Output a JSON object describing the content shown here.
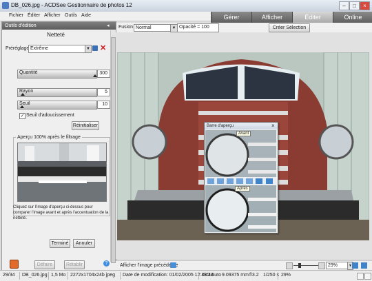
{
  "window": {
    "title": "DB_026.jpg - ACDSee Gestionnaire de photos 12"
  },
  "menu": [
    "Fichier",
    "Éditer",
    "Afficher",
    "Outils",
    "Aide"
  ],
  "modes": [
    "Gérer",
    "Afficher",
    "Éditer",
    "Online"
  ],
  "active_mode": "Éditer",
  "panel": {
    "header": "Outils d'édition",
    "heading": "Netteté",
    "presets_label": "Préréglages",
    "presets_value": "Extrême",
    "quantite_label": "Quantité",
    "quantite_value": "300",
    "rayon_label": "Rayon",
    "rayon_value": "5",
    "seuil_label": "Seuil",
    "seuil_value": "10",
    "seuil_adoucissement_label": "Seuil d'adoucissement",
    "reinitialiser": "Réinitialiser",
    "apercu_group_label": "Aperçu 100% après le filtrage",
    "help_text": "Cliquez sur l'image d'aperçu ci-dessus pour comparer l'image avant et après l'accentuation de la netteté.",
    "termine": "Terminé",
    "annuler": "Annuler",
    "defaire": "Défaire",
    "retablir": "Rétablir"
  },
  "toolbar": {
    "fusion_label": "Fusion",
    "fusion_value": "Normal",
    "opacite_text": "Opacité = 100",
    "creer_selection": "Créer Sélection"
  },
  "preview_bar": {
    "title": "Barre d'aperçu",
    "avant": "Avant",
    "apres": "Après"
  },
  "nav": {
    "prev_image": "Afficher l'image précédente",
    "zoom_value": "29%"
  },
  "status": {
    "index": "29/34",
    "filename": "DB_026.jpg",
    "size": "1,5 Mo",
    "dims": "2272x1704x24b jpeg",
    "date": "Date de modification: 01/02/2005 12:43:48",
    "iso": "ISO Auto",
    "focal": "9.09375 mm",
    "aperture": "f/3.2",
    "shutter": "1/250 s",
    "zoom": "29%"
  },
  "colors": {
    "accent": "#4a7bc4",
    "delete": "#d11d1d",
    "tab_dark": "#6f6f6f"
  }
}
